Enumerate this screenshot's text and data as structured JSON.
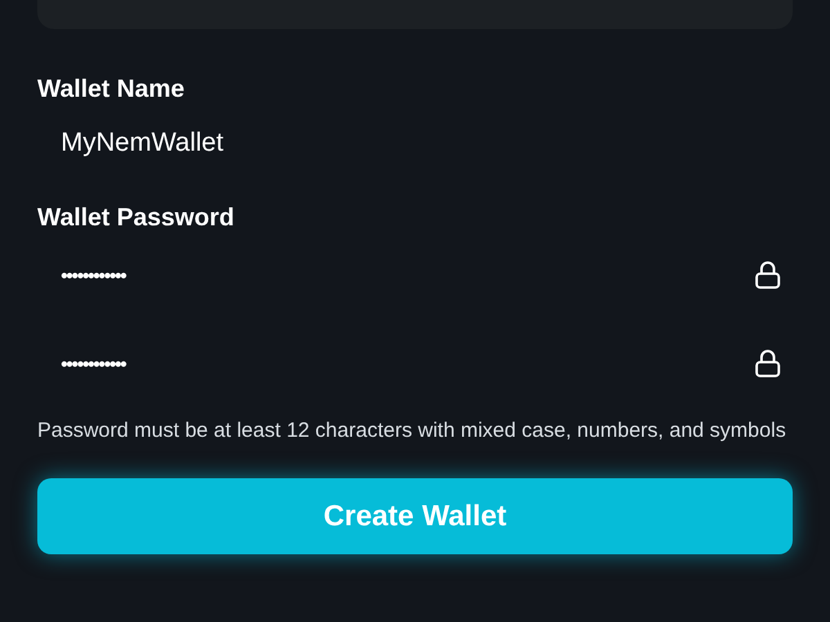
{
  "wallet_name": {
    "label": "Wallet Name",
    "value": "MyNemWallet"
  },
  "wallet_password": {
    "label": "Wallet Password",
    "fields": [
      {
        "value": "••••••••••••"
      },
      {
        "value": "••••••••••••"
      }
    ]
  },
  "hint": "Password must be at least 12 characters with mixed case, numbers, and symbols",
  "button": "Create Wallet"
}
